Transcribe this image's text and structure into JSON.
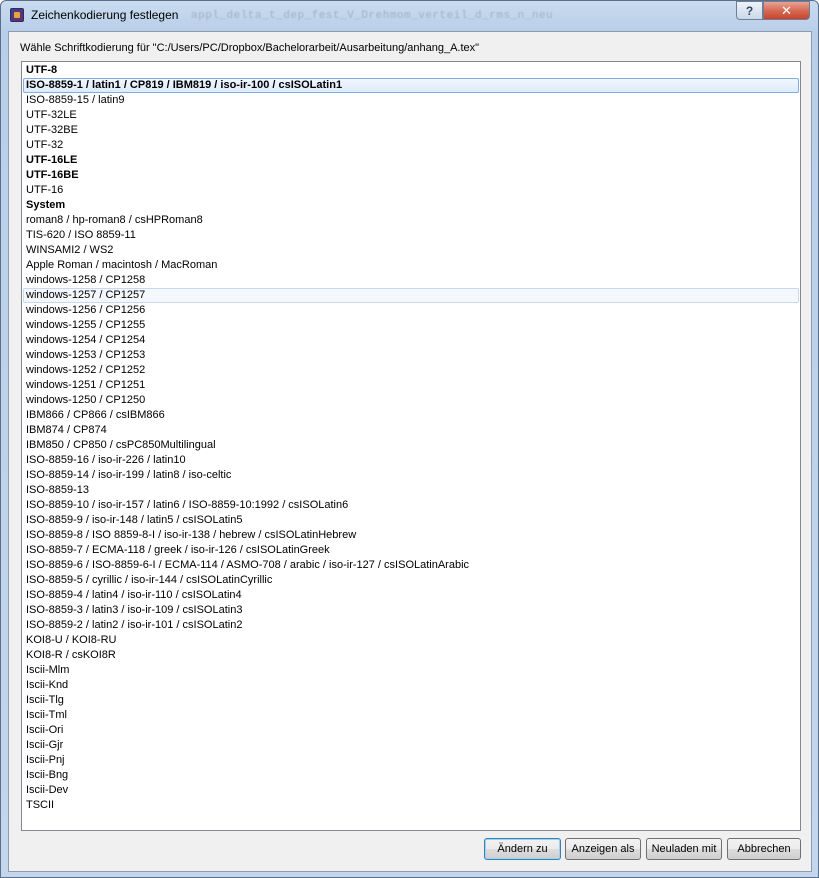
{
  "window": {
    "title": "Zeichenkodierung festlegen",
    "ghost_title": "appl_delta_t_dep_fest_V_Drehmom_verteil_d_rms_n_neu",
    "help_label": "?",
    "close_label": "✕"
  },
  "dialog": {
    "prompt": "Wähle Schriftkodierung für \"C:/Users/PC/Dropbox/Bachelorarbeit/Ausarbeitung/anhang_A.tex\"",
    "selected_index": 1,
    "hover_index": 15,
    "encodings": [
      {
        "label": "UTF-8",
        "bold": true
      },
      {
        "label": "ISO-8859-1 / latin1 / CP819 / IBM819 / iso-ir-100 / csISOLatin1",
        "bold": true
      },
      {
        "label": "ISO-8859-15 / latin9",
        "bold": false
      },
      {
        "label": "UTF-32LE",
        "bold": false
      },
      {
        "label": "UTF-32BE",
        "bold": false
      },
      {
        "label": "UTF-32",
        "bold": false
      },
      {
        "label": "UTF-16LE",
        "bold": true
      },
      {
        "label": "UTF-16BE",
        "bold": true
      },
      {
        "label": "UTF-16",
        "bold": false
      },
      {
        "label": "System",
        "bold": true
      },
      {
        "label": "roman8 / hp-roman8 / csHPRoman8",
        "bold": false
      },
      {
        "label": "TIS-620 / ISO 8859-11",
        "bold": false
      },
      {
        "label": "WINSAMI2 / WS2",
        "bold": false
      },
      {
        "label": "Apple Roman / macintosh / MacRoman",
        "bold": false
      },
      {
        "label": "windows-1258 / CP1258",
        "bold": false
      },
      {
        "label": "windows-1257 / CP1257",
        "bold": false
      },
      {
        "label": "windows-1256 / CP1256",
        "bold": false
      },
      {
        "label": "windows-1255 / CP1255",
        "bold": false
      },
      {
        "label": "windows-1254 / CP1254",
        "bold": false
      },
      {
        "label": "windows-1253 / CP1253",
        "bold": false
      },
      {
        "label": "windows-1252 / CP1252",
        "bold": false
      },
      {
        "label": "windows-1251 / CP1251",
        "bold": false
      },
      {
        "label": "windows-1250 / CP1250",
        "bold": false
      },
      {
        "label": "IBM866 / CP866 / csIBM866",
        "bold": false
      },
      {
        "label": "IBM874 / CP874",
        "bold": false
      },
      {
        "label": "IBM850 / CP850 / csPC850Multilingual",
        "bold": false
      },
      {
        "label": "ISO-8859-16 / iso-ir-226 / latin10",
        "bold": false
      },
      {
        "label": "ISO-8859-14 / iso-ir-199 / latin8 / iso-celtic",
        "bold": false
      },
      {
        "label": "ISO-8859-13",
        "bold": false
      },
      {
        "label": "ISO-8859-10 / iso-ir-157 / latin6 / ISO-8859-10:1992 / csISOLatin6",
        "bold": false
      },
      {
        "label": "ISO-8859-9 / iso-ir-148 / latin5 / csISOLatin5",
        "bold": false
      },
      {
        "label": "ISO-8859-8 / ISO 8859-8-I / iso-ir-138 / hebrew / csISOLatinHebrew",
        "bold": false
      },
      {
        "label": "ISO-8859-7 / ECMA-118 / greek / iso-ir-126 / csISOLatinGreek",
        "bold": false
      },
      {
        "label": "ISO-8859-6 / ISO-8859-6-I / ECMA-114 / ASMO-708 / arabic / iso-ir-127 / csISOLatinArabic",
        "bold": false
      },
      {
        "label": "ISO-8859-5 / cyrillic / iso-ir-144 / csISOLatinCyrillic",
        "bold": false
      },
      {
        "label": "ISO-8859-4 / latin4 / iso-ir-110 / csISOLatin4",
        "bold": false
      },
      {
        "label": "ISO-8859-3 / latin3 / iso-ir-109 / csISOLatin3",
        "bold": false
      },
      {
        "label": "ISO-8859-2 / latin2 / iso-ir-101 / csISOLatin2",
        "bold": false
      },
      {
        "label": "KOI8-U / KOI8-RU",
        "bold": false
      },
      {
        "label": "KOI8-R / csKOI8R",
        "bold": false
      },
      {
        "label": "Iscii-Mlm",
        "bold": false
      },
      {
        "label": "Iscii-Knd",
        "bold": false
      },
      {
        "label": "Iscii-Tlg",
        "bold": false
      },
      {
        "label": "Iscii-Tml",
        "bold": false
      },
      {
        "label": "Iscii-Ori",
        "bold": false
      },
      {
        "label": "Iscii-Gjr",
        "bold": false
      },
      {
        "label": "Iscii-Pnj",
        "bold": false
      },
      {
        "label": "Iscii-Bng",
        "bold": false
      },
      {
        "label": "Iscii-Dev",
        "bold": false
      },
      {
        "label": "TSCII",
        "bold": false
      }
    ]
  },
  "buttons": {
    "change_to": "Ändern zu",
    "show_as": "Anzeigen als",
    "reload_with": "Neuladen mit",
    "cancel": "Abbrechen"
  }
}
